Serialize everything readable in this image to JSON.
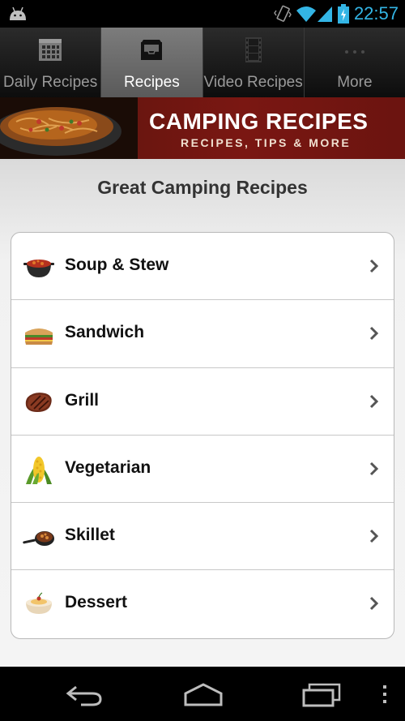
{
  "status_bar": {
    "time": "22:57",
    "icons": [
      "android-icon",
      "vibrate-icon",
      "wifi-icon",
      "signal-icon",
      "battery-charging-icon"
    ]
  },
  "tabs": [
    {
      "label": "Daily Recipes",
      "icon": "calendar-icon",
      "active": false
    },
    {
      "label": "Recipes",
      "icon": "inbox-icon",
      "active": true
    },
    {
      "label": "Video Recipes",
      "icon": "film-icon",
      "active": false
    },
    {
      "label": "More",
      "icon": "more-dots-icon",
      "active": false
    }
  ],
  "banner": {
    "title": "CAMPING RECIPES",
    "subtitle": "RECIPES, TIPS & MORE"
  },
  "page_title": "Great Camping Recipes",
  "categories": [
    {
      "label": "Soup & Stew",
      "icon": "soup-pot-icon"
    },
    {
      "label": "Sandwich",
      "icon": "sandwich-icon"
    },
    {
      "label": "Grill",
      "icon": "steak-icon"
    },
    {
      "label": "Vegetarian",
      "icon": "corn-icon"
    },
    {
      "label": "Skillet",
      "icon": "skillet-icon"
    },
    {
      "label": "Dessert",
      "icon": "dessert-bowl-icon"
    }
  ],
  "nav_bar": {
    "buttons": [
      "back-icon",
      "home-icon",
      "recents-icon",
      "overflow-menu-icon"
    ]
  },
  "colors": {
    "accent": "#33b5e5",
    "banner": "#6b1610",
    "active_tab": "#6a6a6a"
  }
}
